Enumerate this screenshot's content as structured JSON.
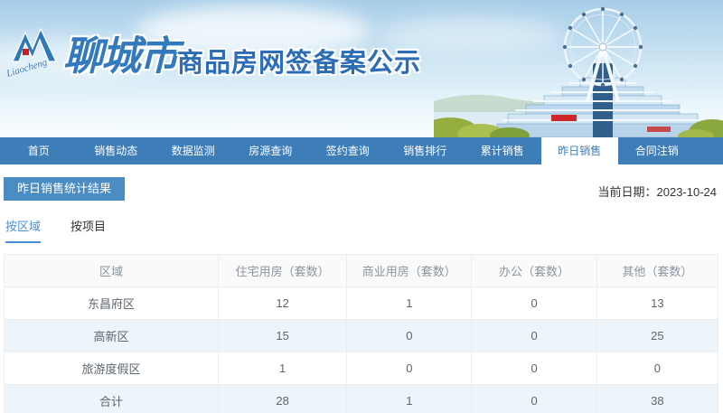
{
  "banner": {
    "logo_script": "Liaocheng",
    "city_name": "聊城市",
    "site_title": "商品房网签备案公示"
  },
  "nav": {
    "items": [
      {
        "label": "首页",
        "active": false
      },
      {
        "label": "销售动态",
        "active": false
      },
      {
        "label": "数据监测",
        "active": false
      },
      {
        "label": "房源查询",
        "active": false
      },
      {
        "label": "签约查询",
        "active": false
      },
      {
        "label": "销售排行",
        "active": false
      },
      {
        "label": "累计销售",
        "active": false
      },
      {
        "label": "昨日销售",
        "active": true
      },
      {
        "label": "合同注销",
        "active": false
      }
    ]
  },
  "page": {
    "section_title": "昨日销售统计结果",
    "date_label": "当前日期：",
    "date_value": "2023-10-24"
  },
  "tabs": [
    {
      "label": "按区域",
      "active": true
    },
    {
      "label": "按项目",
      "active": false
    }
  ],
  "table": {
    "columns": [
      "区域",
      "住宅用房（套数）",
      "商业用房（套数）",
      "办公（套数）",
      "其他（套数）"
    ],
    "rows": [
      {
        "region": "东昌府区",
        "values": [
          "12",
          "1",
          "0",
          "13"
        ]
      },
      {
        "region": "高新区",
        "values": [
          "15",
          "0",
          "0",
          "25"
        ]
      },
      {
        "region": "旅游度假区",
        "values": [
          "1",
          "0",
          "0",
          "0"
        ]
      },
      {
        "region": "合计",
        "values": [
          "28",
          "1",
          "0",
          "38"
        ]
      }
    ]
  },
  "colors": {
    "nav_blue": "#3d7db8",
    "badge_blue": "#4a8cc4",
    "accent_blue": "#4a90d9",
    "title_blue": "#2c6db6",
    "stripe_row": "#edf5fb",
    "table_border": "#ededed",
    "header_bg": "#fafafa"
  }
}
